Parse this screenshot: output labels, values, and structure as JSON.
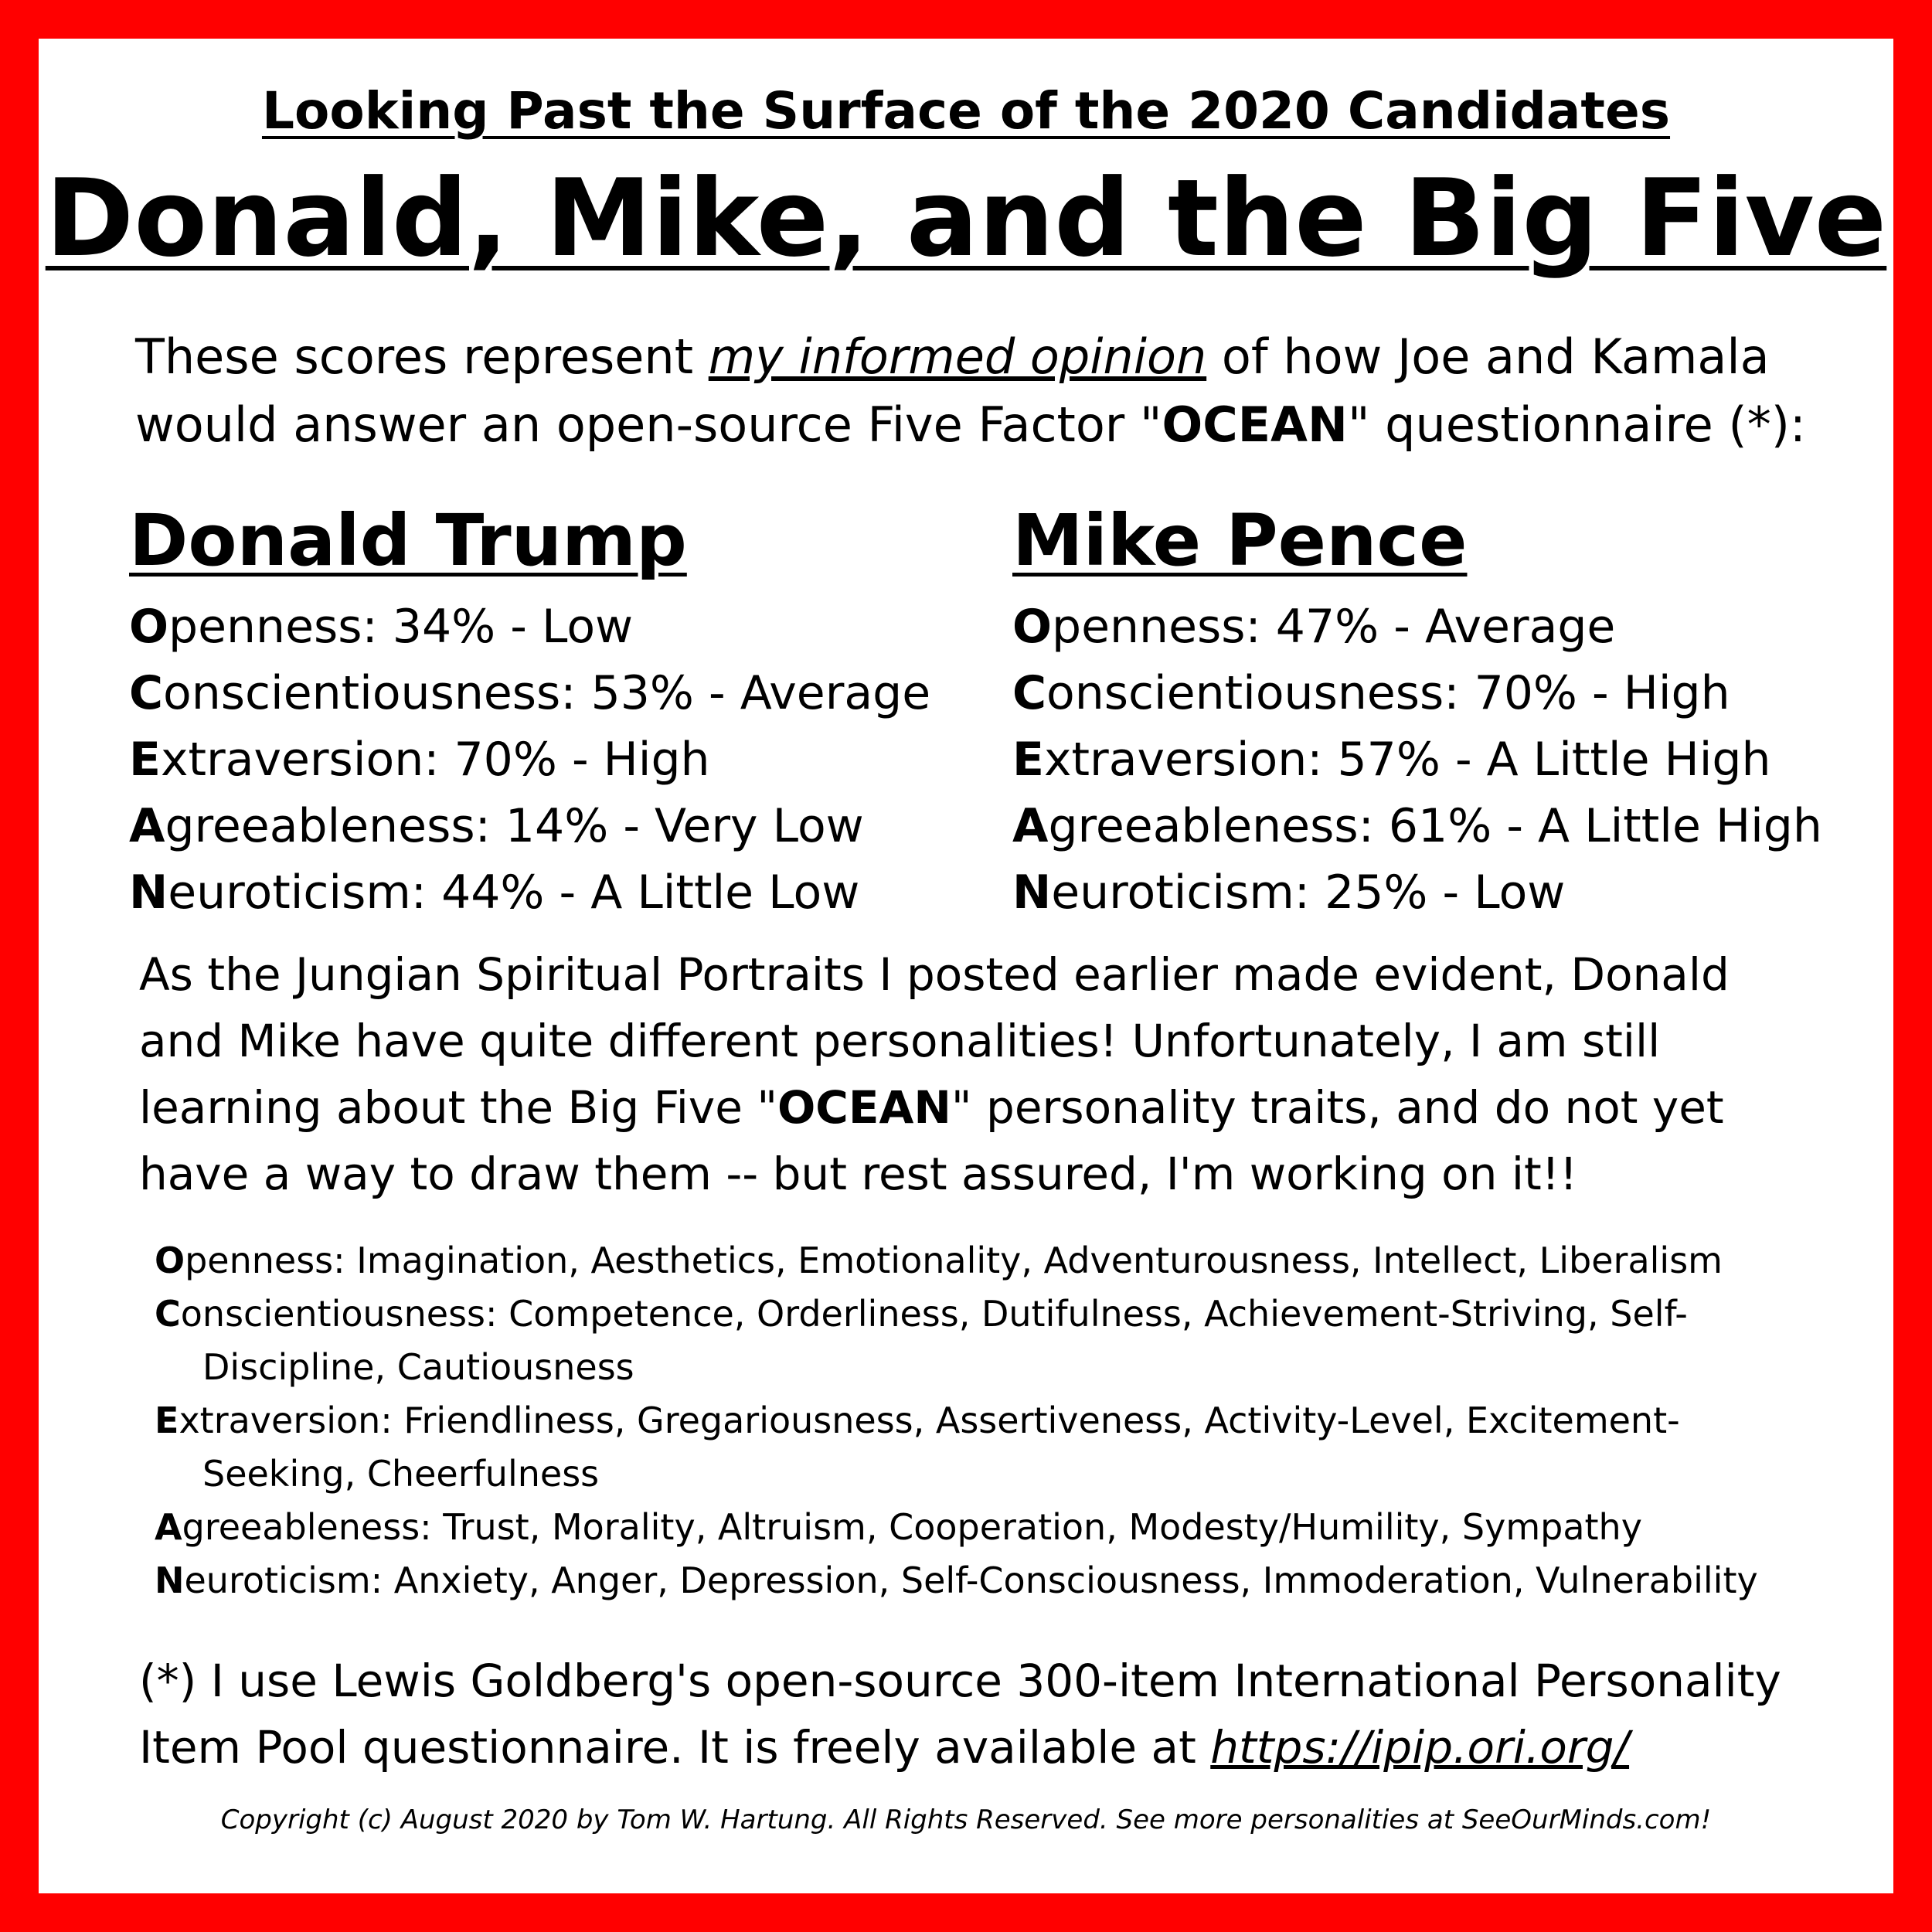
{
  "supertitle": "Looking Past the Surface of the 2020 Candidates",
  "title": "Donald, Mike, and the Big Five",
  "intro": {
    "p1": "These scores represent ",
    "emphasis": "my informed opinion",
    "p2": " of how Joe and Kamala would answer an open-source Five Factor \"",
    "bold": "OCEAN",
    "p3": "\" questionnaire (*):"
  },
  "candidates": [
    {
      "name": "Donald Trump",
      "traits": [
        {
          "initial": "O",
          "rest": "penness: 34% - Low"
        },
        {
          "initial": "C",
          "rest": "onscientiousness: 53% - Average"
        },
        {
          "initial": "E",
          "rest": "xtraversion:  70% - High"
        },
        {
          "initial": "A",
          "rest": "greeableness: 14% - Very Low"
        },
        {
          "initial": "N",
          "rest": "euroticism: 44% - A Little Low"
        }
      ]
    },
    {
      "name": "Mike Pence",
      "traits": [
        {
          "initial": "O",
          "rest": "penness: 47% - Average"
        },
        {
          "initial": "C",
          "rest": "onscientiousness: 70% - High"
        },
        {
          "initial": "E",
          "rest": "xtraversion:  57% - A Little High"
        },
        {
          "initial": "A",
          "rest": "greeableness: 61% - A Little High"
        },
        {
          "initial": "N",
          "rest": "euroticism: 25% - Low"
        }
      ]
    }
  ],
  "paragraph": {
    "p1": "As the Jungian Spiritual Portraits I posted earlier made evident, Donald and Mike have quite different personalities!  Unfortunately, I am still learning about the Big Five \"",
    "bold": "OCEAN",
    "p2": "\" personality traits, and do not yet have a way to draw them -- but rest assured, I'm working on it!!"
  },
  "facets": [
    {
      "initial": "O",
      "rest": "penness: Imagination, Aesthetics, Emotionality, Adventurousness, Intellect, Liberalism"
    },
    {
      "initial": "C",
      "rest": "onscientiousness: Competence, Orderliness, Dutifulness, Achievement-Striving,  Self-Discipline, Cautiousness"
    },
    {
      "initial": "E",
      "rest": "xtraversion: Friendliness, Gregariousness, Assertiveness, Activity-Level, Excitement-Seeking, Cheerfulness"
    },
    {
      "initial": "A",
      "rest": "greeableness: Trust, Morality, Altruism, Cooperation, Modesty/Humility, Sympathy"
    },
    {
      "initial": "N",
      "rest": "euroticism: Anxiety, Anger, Depression, Self-Consciousness, Immoderation, Vulnerability"
    }
  ],
  "footnote": {
    "text": "(*) I use Lewis Goldberg's open-source 300-item International Personality Item Pool questionnaire.  It is freely available at ",
    "link": "https://ipip.ori.org/"
  },
  "copyright": "Copyright (c) August 2020 by Tom W. Hartung.  All Rights Reserved.  See more personalities at SeeOurMinds.com!",
  "colors": {
    "border": "#ff0000",
    "background": "#ffffff",
    "text": "#000000"
  }
}
